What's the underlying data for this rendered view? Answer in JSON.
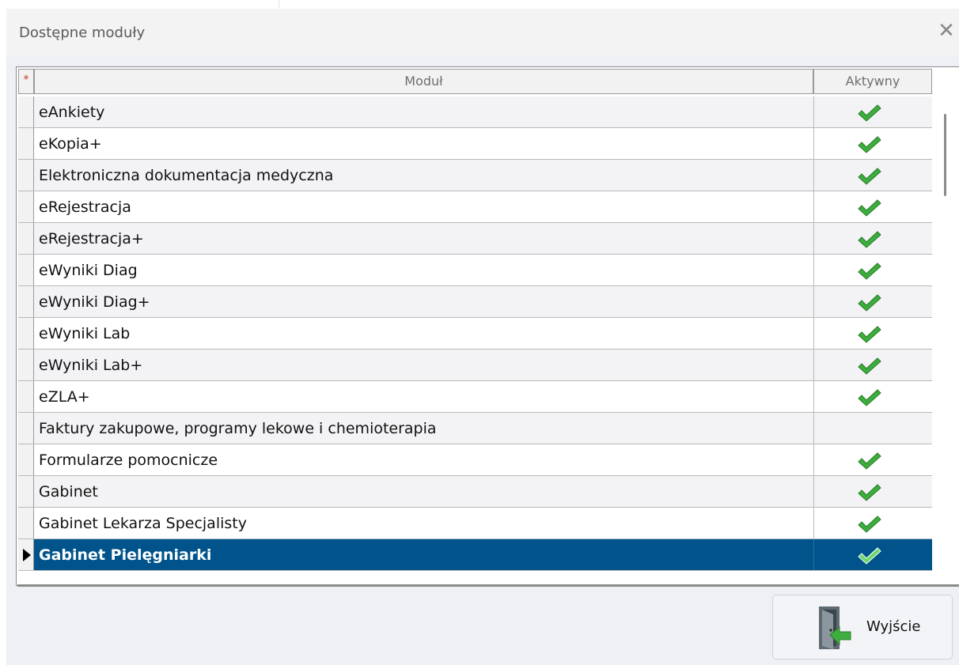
{
  "window": {
    "title": "Dostępne moduły",
    "close_glyph": "✕"
  },
  "grid": {
    "header_marker": "*",
    "columns": [
      "Moduł",
      "Aktywny"
    ],
    "rows": [
      {
        "name": "eAnkiety",
        "active": true
      },
      {
        "name": "eKopia+",
        "active": true
      },
      {
        "name": "Elektroniczna dokumentacja medyczna",
        "active": true
      },
      {
        "name": "eRejestracja",
        "active": true
      },
      {
        "name": "eRejestracja+",
        "active": true
      },
      {
        "name": "eWyniki Diag",
        "active": true
      },
      {
        "name": "eWyniki Diag+",
        "active": true
      },
      {
        "name": "eWyniki Lab",
        "active": true
      },
      {
        "name": "eWyniki Lab+",
        "active": true
      },
      {
        "name": "eZLA+",
        "active": true
      },
      {
        "name": "Faktury zakupowe, programy lekowe i chemioterapia",
        "active": false
      },
      {
        "name": "Formularze pomocnicze",
        "active": true
      },
      {
        "name": "Gabinet",
        "active": true
      },
      {
        "name": "Gabinet Lekarza Specjalisty",
        "active": true
      },
      {
        "name": "Gabinet Pielęgniarki",
        "active": true,
        "selected": true
      }
    ]
  },
  "buttons": {
    "exit_label": "Wyjście",
    "exit_icon": "door-exit-icon"
  },
  "colors": {
    "selection": "#00548b",
    "check": "#3cae3c"
  }
}
